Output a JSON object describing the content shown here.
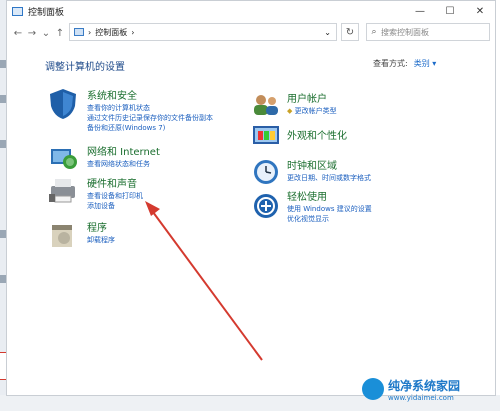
{
  "window": {
    "title": "控制面板",
    "min": "—",
    "max": "☐",
    "close": "✕"
  },
  "nav": {
    "back": "←",
    "forward": "→",
    "dropdown": "⌄",
    "up": "↑",
    "sep": "›",
    "breadcrumb": "控制面板",
    "dd2": "⌄",
    "refresh": "↻"
  },
  "search": {
    "placeholder": "搜索控制面板"
  },
  "content": {
    "heading": "调整计算机的设置",
    "viewby_label": "查看方式:",
    "viewby_value": "类别 ▾"
  },
  "left_items": [
    {
      "title": "系统和安全",
      "links": [
        "查看你的计算机状态",
        "通过文件历史记录保存你的文件备份副本",
        "备份和还原(Windows 7)"
      ]
    },
    {
      "title": "网络和 Internet",
      "links": [
        "查看网络状态和任务"
      ]
    },
    {
      "title": "硬件和声音",
      "links": [
        "查看设备和打印机",
        "添加设备"
      ]
    },
    {
      "title": "程序",
      "links": [
        "卸载程序"
      ]
    }
  ],
  "right_items": [
    {
      "title": "用户帐户",
      "links": [
        "更改帐户类型"
      ]
    },
    {
      "title": "外观和个性化",
      "links": []
    },
    {
      "title": "时钟和区域",
      "links": [
        "更改日期、时间或数字格式"
      ]
    },
    {
      "title": "轻松使用",
      "links": [
        "使用 Windows 建议的设置",
        "优化视觉显示"
      ]
    }
  ],
  "watermark": {
    "text": "纯净系统家园",
    "url": "www.yidaimei.com"
  },
  "colors": {
    "accent": "#1b5fbf",
    "title_green": "#1a6e2e",
    "arrow_red": "#d43a2f"
  }
}
